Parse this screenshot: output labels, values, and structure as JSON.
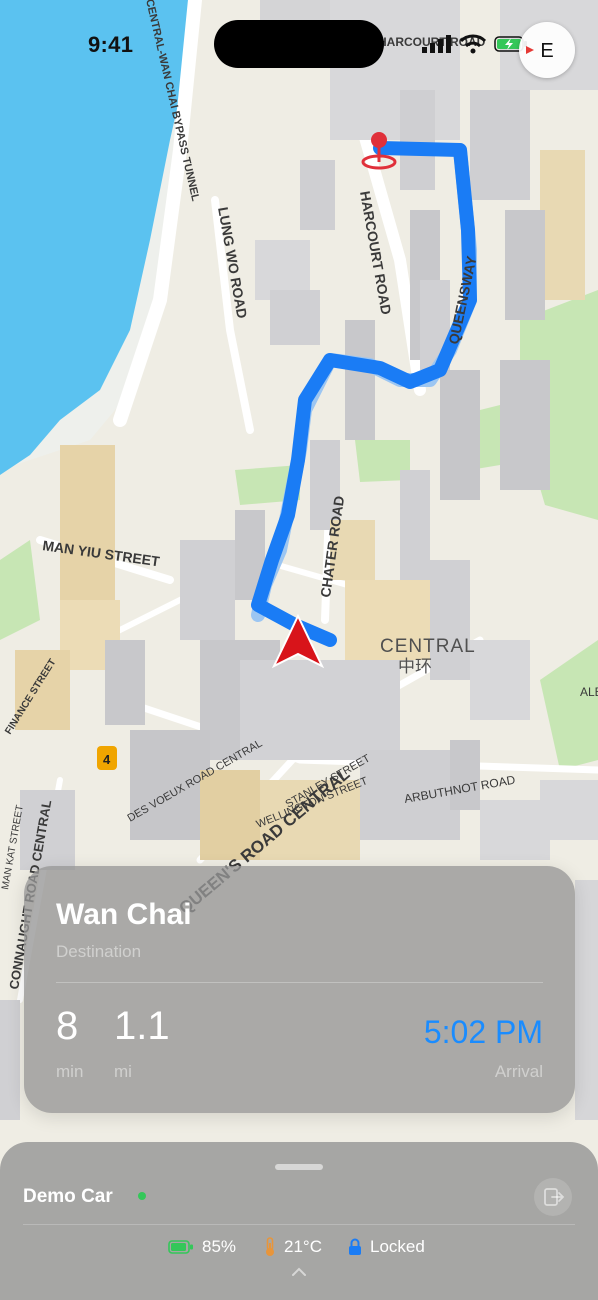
{
  "status_bar": {
    "time": "9:41"
  },
  "compass": {
    "heading": "E"
  },
  "map": {
    "labels": [
      {
        "text": "CENTRAL-WAN CHAI BYPASS TUNNEL"
      },
      {
        "text": "LUNG WO ROAD"
      },
      {
        "text": "HARCOURT ROAD"
      },
      {
        "text": "QUEENSWAY"
      },
      {
        "text": "MAN YIU STREET"
      },
      {
        "text": "CHATER ROAD"
      },
      {
        "text": "CENTRAL"
      },
      {
        "text": "中环"
      },
      {
        "text": "FINANCE STREET"
      },
      {
        "text": "DES VOEUX ROAD CENTRAL"
      },
      {
        "text": "QUEEN'S ROAD CENTRAL"
      },
      {
        "text": "STANLEY STREET"
      },
      {
        "text": "WELLINGTON STREET"
      },
      {
        "text": "ARBUTHNOT ROAD"
      },
      {
        "text": "CONNAUGHT ROAD CENTRAL"
      },
      {
        "text": "MAN KAT STREET"
      },
      {
        "text": "ALE"
      },
      {
        "text": "4"
      },
      {
        "text": "HARCOURT ROAD"
      }
    ],
    "colors": {
      "route": "#1a7cf5",
      "route_faded": "#9cc6f2",
      "water": "#5bc2f0",
      "park": "#c7e6b4",
      "cursor": "#d8141a",
      "pin": "#e0303a"
    }
  },
  "destination": {
    "name": "Wan Chai",
    "subtitle": "Destination",
    "time_value": "8",
    "time_unit": "min",
    "distance_value": "1.1",
    "distance_unit": "mi",
    "arrival_time": "5:02 PM",
    "arrival_label": "Arrival"
  },
  "vehicle": {
    "name": "Demo Car",
    "connected_color": "#34c759",
    "battery": "85%",
    "temperature": "21°C",
    "lock_status": "Locked"
  }
}
